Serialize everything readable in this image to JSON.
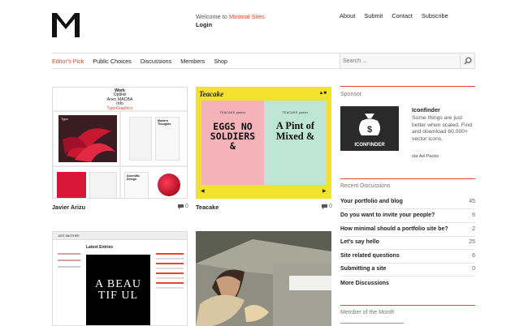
{
  "welcome": {
    "prefix": "Welcome to ",
    "brand": "Minimal Sites",
    "login": "Login"
  },
  "topnav": [
    "About",
    "Submit",
    "Contact",
    "Subscribe"
  ],
  "subnav": [
    {
      "label": "Editor's Pick",
      "active": true
    },
    {
      "label": "Public Choices",
      "active": false
    },
    {
      "label": "Discussions",
      "active": false
    },
    {
      "label": "Members",
      "active": false
    },
    {
      "label": "Shop",
      "active": false
    }
  ],
  "search": {
    "placeholder": "Search ..."
  },
  "sites": [
    {
      "title": "Javier Arizu",
      "comments": "0"
    },
    {
      "title": "Teacake",
      "comments": "0"
    }
  ],
  "thumb1": {
    "line1": "Work",
    "line2": "Optikki",
    "line3": "Anec MACBA",
    "line4": "Info",
    "line5": "TypoGraphics",
    "panel_a": "Typo",
    "panel_b": "Modern Thoughts",
    "panel_c": "Scientific Design"
  },
  "thumb2": {
    "brand": "Teacake",
    "label": "TEACAKE poster",
    "left_text": "EGGS NO SOLDIERS &",
    "right_text": "A Pint of Mixed &"
  },
  "thumb3": {
    "nav": "JUST ANOTHER",
    "heading": "Latest Entries",
    "article": "A BEAU TIF UL"
  },
  "sidebar": {
    "sponsor_heading": "Sponsor",
    "ad": {
      "title": "Iconfinder",
      "text": "Some things are just better when scaled. Find and download 60.000+ vector icons.",
      "logo": "ICONFINDER",
      "via": "via Ad Packs"
    },
    "recent_heading": "Recent Discussions",
    "discussions": [
      {
        "title": "Your portfolio and blog",
        "count": "45"
      },
      {
        "title": "Do you want to invite your people?",
        "count": "6"
      },
      {
        "title": "How minimal should a portfolio site be?",
        "count": "2"
      },
      {
        "title": "Let's say hello",
        "count": "25"
      },
      {
        "title": "Site related questions",
        "count": "6"
      },
      {
        "title": "Submitting a site",
        "count": "0"
      }
    ],
    "more": "More Discussions",
    "member_heading": "Member of the Month"
  },
  "colors": {
    "accent": "#e8452c",
    "teacake_yellow": "#f1e22b",
    "pink": "#f4b3b9",
    "mint": "#bfe5d7"
  }
}
